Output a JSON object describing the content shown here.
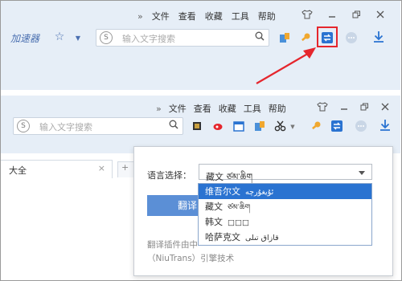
{
  "top": {
    "menu": [
      "文件",
      "查看",
      "收藏",
      "工具",
      "帮助"
    ],
    "accelerator_label": "加速器",
    "search_placeholder": "输入文字搜索"
  },
  "bottom": {
    "menu": [
      "文件",
      "查看",
      "收藏",
      "工具",
      "帮助"
    ],
    "search_placeholder": "输入文字搜索",
    "tab_label": "大全",
    "tab_close": "×",
    "new_tab": "+"
  },
  "popup": {
    "language_label": "语言选择：",
    "selected_value": "藏文  ཙམ་ཆིག",
    "translate_button": "翻译",
    "footer_line1": "翻译插件由中",
    "footer_line2": "（NiuTrans）引擎技术",
    "options": [
      {
        "name": "维吾尔文",
        "script": "ئۇيغۇرچە"
      },
      {
        "name": "藏文",
        "script": "ཙམ་ཆིག"
      },
      {
        "name": "韩文",
        "script": "□□□"
      },
      {
        "name": "哈萨克文",
        "script": "قازاق تىلى"
      }
    ]
  },
  "colors": {
    "highlight": "#e5262d",
    "accent": "#2a73d1",
    "toolbar_bg": "#e6eef7"
  }
}
